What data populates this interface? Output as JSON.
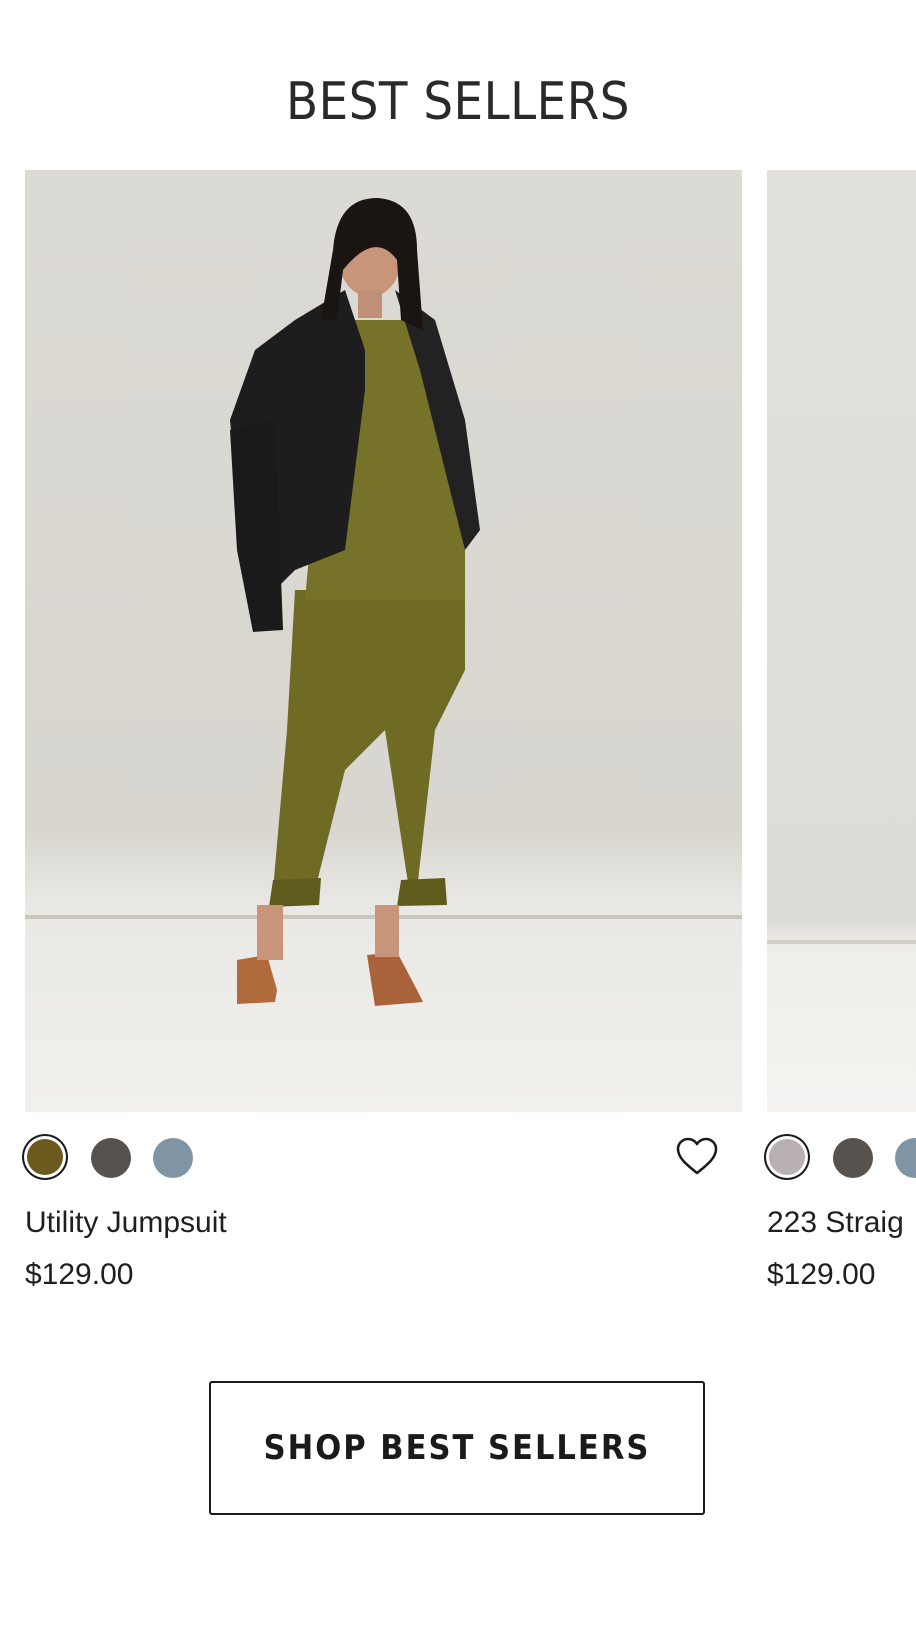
{
  "section": {
    "title": "BEST SELLERS"
  },
  "products": [
    {
      "name": "Utility Jumpsuit",
      "price": "$129.00",
      "image_alt": "Model wearing olive utility jumpsuit with black leather jacket",
      "swatches": [
        {
          "color": "#6b5a1e",
          "selected": true
        },
        {
          "color": "#57524d",
          "selected": false
        },
        {
          "color": "#7f95a6",
          "selected": false
        }
      ],
      "wishlist_icon": "heart-outline-icon"
    },
    {
      "name": "223 Straig",
      "price": "$129.00",
      "swatches": [
        {
          "color": "#b8b0b2",
          "selected": true
        },
        {
          "color": "#57524d",
          "selected": false
        },
        {
          "color": "#7f95a6",
          "selected": false
        }
      ]
    }
  ],
  "cta": {
    "label": "SHOP BEST SELLERS"
  },
  "colors": {
    "jumpsuit": "#6f6b24",
    "jacket": "#1d1d1d",
    "boots": "#b06a3b",
    "skin": "#c9957a",
    "hair": "#1a1412"
  }
}
